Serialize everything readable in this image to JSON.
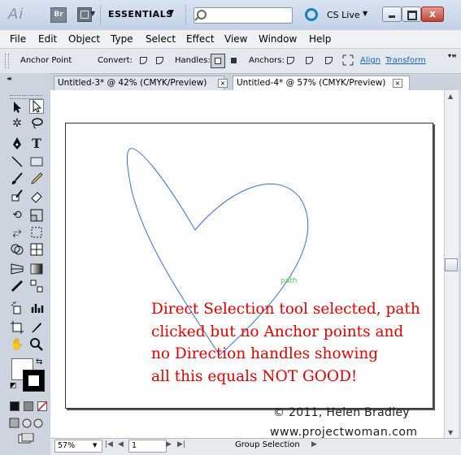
{
  "titlebar": {
    "logo": "Ai",
    "br_label": "Br",
    "workspace": "ESSENTIALS",
    "search_placeholder": "",
    "cslive": "CS Live",
    "close_glyph": "x"
  },
  "menu": [
    "File",
    "Edit",
    "Object",
    "Type",
    "Select",
    "Effect",
    "View",
    "Window",
    "Help"
  ],
  "control": {
    "label": "Anchor Point",
    "convert": "Convert:",
    "handles": "Handles:",
    "anchors": "Anchors:",
    "align": "Align",
    "transform": "Transform"
  },
  "tabs": [
    {
      "label": "Untitled-3* @ 42% (CMYK/Preview)"
    },
    {
      "label": "Untitled-4* @ 57% (CMYK/Preview)"
    }
  ],
  "canvas": {
    "path_label": "path",
    "annotation": [
      "Direct Selection tool selected, path",
      "clicked but no Anchor points and",
      "no Direction handles showing",
      "all this equals NOT GOOD!"
    ],
    "copyright": "© 2011, Helen Bradley",
    "website": "www.projectwoman.com"
  },
  "status": {
    "zoom": "57%",
    "page": "1",
    "tool": "Group Selection"
  },
  "colors": {
    "annotation": "#e00000",
    "path_stroke": "#3b6fc4",
    "path_label": "#4cc24c",
    "link": "#1762b3"
  }
}
